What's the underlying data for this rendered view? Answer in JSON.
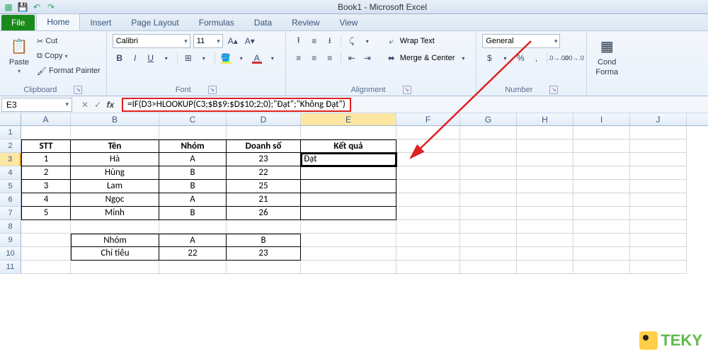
{
  "titlebar": {
    "app_title": "Book1 - Microsoft Excel"
  },
  "tabs": {
    "file": "File",
    "home": "Home",
    "insert": "Insert",
    "page_layout": "Page Layout",
    "formulas": "Formulas",
    "data": "Data",
    "review": "Review",
    "view": "View"
  },
  "ribbon": {
    "clipboard": {
      "paste": "Paste",
      "cut": "Cut",
      "copy": "Copy",
      "format_painter": "Format Painter",
      "label": "Clipboard"
    },
    "font": {
      "family": "Calibri",
      "size": "11",
      "label": "Font"
    },
    "alignment": {
      "wrap": "Wrap Text",
      "merge": "Merge & Center",
      "label": "Alignment"
    },
    "number": {
      "format": "General",
      "label": "Number"
    },
    "styles": {
      "cond": "Cond",
      "cond2": "Forma"
    }
  },
  "namebox": "E3",
  "formula": "=IF(D3>HLOOKUP(C3;$B$9:$D$10;2;0);\"Đạt\";\"Không Đạt\")",
  "columns": [
    "A",
    "B",
    "C",
    "D",
    "E",
    "F",
    "G",
    "H",
    "I",
    "J"
  ],
  "rows": [
    "1",
    "2",
    "3",
    "4",
    "5",
    "6",
    "7",
    "8",
    "9",
    "10",
    "11"
  ],
  "table1_headers": {
    "stt": "STT",
    "ten": "Tên",
    "nhom": "Nhóm",
    "doanhso": "Doanh số",
    "ketqua": "Kết quả"
  },
  "table1": [
    {
      "stt": "1",
      "ten": "Hà",
      "nhom": "A",
      "ds": "23",
      "kq": "Đạt"
    },
    {
      "stt": "2",
      "ten": "Hùng",
      "nhom": "B",
      "ds": "22",
      "kq": ""
    },
    {
      "stt": "3",
      "ten": "Lam",
      "nhom": "B",
      "ds": "25",
      "kq": ""
    },
    {
      "stt": "4",
      "ten": "Ngọc",
      "nhom": "A",
      "ds": "21",
      "kq": ""
    },
    {
      "stt": "5",
      "ten": "Minh",
      "nhom": "B",
      "ds": "26",
      "kq": ""
    }
  ],
  "table2": {
    "h1": "Nhóm",
    "h2": "Chỉ tiêu",
    "c1": "A",
    "c2": "B",
    "v1": "22",
    "v2": "23"
  },
  "watermark": "TEKY"
}
